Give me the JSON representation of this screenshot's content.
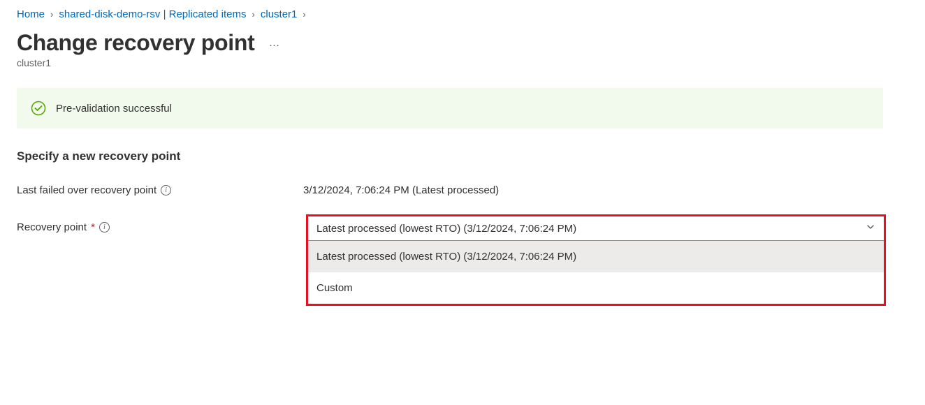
{
  "breadcrumb": {
    "home": "Home",
    "item1": "shared-disk-demo-rsv | Replicated items",
    "item2": "cluster1"
  },
  "page": {
    "title": "Change recovery point",
    "subtitle": "cluster1"
  },
  "status": {
    "message": "Pre-validation successful"
  },
  "section": {
    "heading": "Specify a new recovery point"
  },
  "lastFailed": {
    "label": "Last failed over recovery point",
    "value": "3/12/2024, 7:06:24 PM (Latest processed)"
  },
  "recoveryPoint": {
    "label": "Recovery point",
    "selected": "Latest processed (lowest RTO) (3/12/2024, 7:06:24 PM)",
    "options": [
      "Latest processed (lowest RTO) (3/12/2024, 7:06:24 PM)",
      "Custom"
    ]
  }
}
